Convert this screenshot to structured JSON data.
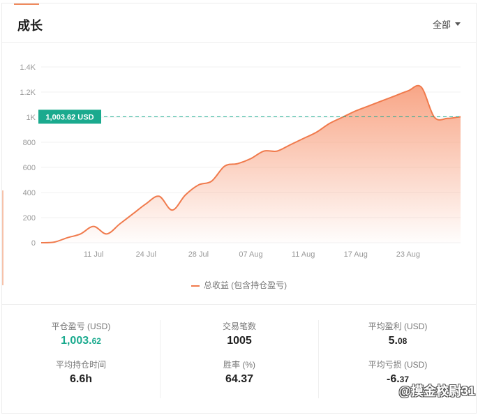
{
  "header": {
    "title": "成长",
    "filter_label": "全部"
  },
  "colors": {
    "line": "#f07a4c",
    "fill_top": "#f8a180",
    "marker": "#1aaa8e"
  },
  "marker": {
    "label": "1,003.62 USD",
    "value": 1003.62
  },
  "legend": {
    "label": "总收益 (包含持仓盈亏)"
  },
  "chart_data": {
    "type": "area",
    "y_ticks": [
      "0",
      "200",
      "400",
      "600",
      "800",
      "1K",
      "1.2K",
      "1.4K"
    ],
    "y_tick_values": [
      0,
      200,
      400,
      600,
      800,
      1000,
      1200,
      1400
    ],
    "x_ticks": [
      "11 Jul",
      "24 Jul",
      "28 Jul",
      "07 Aug",
      "11 Aug",
      "17 Aug",
      "23 Aug"
    ],
    "x_tick_index": [
      4,
      8,
      12,
      16,
      20,
      24,
      28
    ],
    "ylim": [
      0,
      1400
    ],
    "x_count": 33,
    "values": [
      0,
      5,
      40,
      70,
      130,
      70,
      150,
      230,
      310,
      370,
      260,
      380,
      460,
      490,
      610,
      630,
      670,
      730,
      730,
      780,
      830,
      880,
      950,
      1000,
      1050,
      1090,
      1130,
      1170,
      1210,
      1240,
      1000,
      990,
      1003.62
    ],
    "series": [
      {
        "name": "总收益 (包含持仓盈亏)"
      }
    ],
    "grid": true
  },
  "stats": {
    "col1": {
      "label1": "平仓盈亏 (USD)",
      "value1_int": "1,003.",
      "value1_dec": "62",
      "label2": "平均持仓时间",
      "value2": "6.6h"
    },
    "col2": {
      "label1": "交易笔数",
      "value1": "1005",
      "label2": "胜率 (%)",
      "value2": "64.37"
    },
    "col3": {
      "label1": "平均盈利 (USD)",
      "value1_int": "5.",
      "value1_dec": "08",
      "label2": "平均亏损 (USD)",
      "value2_int": "-6.",
      "value2_dec": "37"
    }
  },
  "watermark": "@摸金校尉31"
}
